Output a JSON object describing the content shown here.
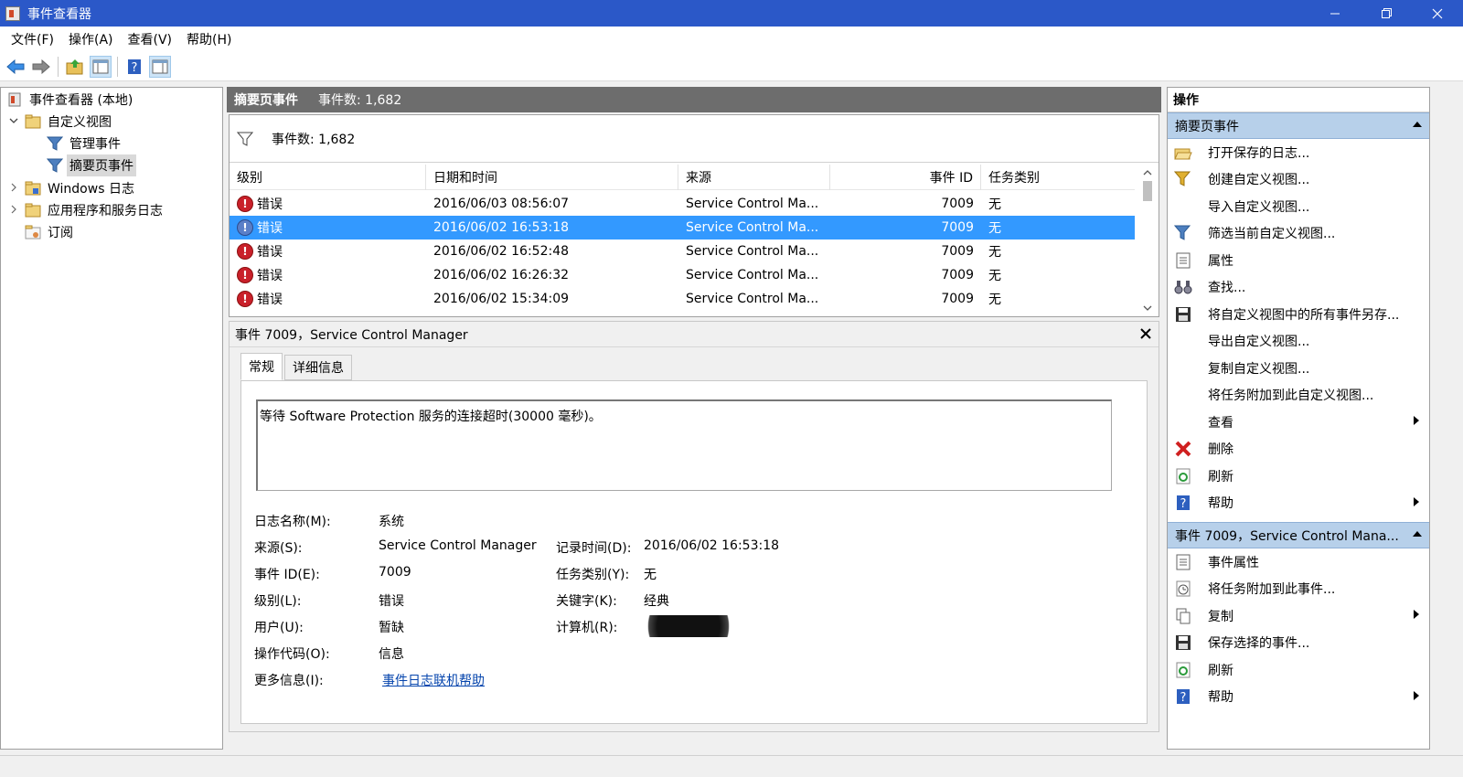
{
  "window": {
    "title": "事件查看器",
    "app_icon": "event-viewer-icon",
    "accent": "#2b58c8"
  },
  "menu": [
    "文件(F)",
    "操作(A)",
    "查看(V)",
    "帮助(H)"
  ],
  "tree": {
    "root": "事件查看器 (本地)",
    "custom_views": "自定义视图",
    "admin_events": "管理事件",
    "summary_events": "摘要页事件",
    "windows_logs": "Windows 日志",
    "app_service_logs": "应用程序和服务日志",
    "subscriptions": "订阅"
  },
  "center": {
    "header_title": "摘要页事件",
    "header_count": "事件数: 1,682",
    "filter_count": "事件数: 1,682",
    "columns": [
      "级别",
      "日期和时间",
      "来源",
      "事件 ID",
      "任务类别"
    ],
    "rows": [
      {
        "level": "错误",
        "datetime": "2016/06/03 08:56:07",
        "source": "Service Control Ma...",
        "id": "7009",
        "category": "无",
        "selected": false
      },
      {
        "level": "错误",
        "datetime": "2016/06/02 16:53:18",
        "source": "Service Control Ma...",
        "id": "7009",
        "category": "无",
        "selected": true
      },
      {
        "level": "错误",
        "datetime": "2016/06/02 16:52:48",
        "source": "Service Control Ma...",
        "id": "7009",
        "category": "无",
        "selected": false
      },
      {
        "level": "错误",
        "datetime": "2016/06/02 16:26:32",
        "source": "Service Control Ma...",
        "id": "7009",
        "category": "无",
        "selected": false
      },
      {
        "level": "错误",
        "datetime": "2016/06/02 15:34:09",
        "source": "Service Control Ma...",
        "id": "7009",
        "category": "无",
        "selected": false
      }
    ]
  },
  "detail": {
    "title": "事件 7009，Service Control Manager",
    "tabs": [
      "常规",
      "详细信息"
    ],
    "message": "等待 Software Protection 服务的连接超时(30000 毫秒)。",
    "log_name_label": "日志名称(M):",
    "log_name": "系统",
    "source_label": "来源(S):",
    "source": "Service Control Manager",
    "logged_label": "记录时间(D):",
    "logged": "2016/06/02 16:53:18",
    "event_id_label": "事件 ID(E):",
    "event_id": "7009",
    "task_label": "任务类别(Y):",
    "task": "无",
    "level_label": "级别(L):",
    "level": "错误",
    "keywords_label": "关键字(K):",
    "keywords": "经典",
    "user_label": "用户(U):",
    "user": "暂缺",
    "computer_label": "计算机(R):",
    "opcode_label": "操作代码(O):",
    "opcode": "信息",
    "more_label": "更多信息(I):",
    "more_link": "事件日志联机帮助"
  },
  "actions": {
    "title": "操作",
    "section1": "摘要页事件",
    "items1": [
      {
        "label": "打开保存的日志...",
        "icon": "folder-open-icon",
        "submenu": false
      },
      {
        "label": "创建自定义视图...",
        "icon": "filter-add-icon",
        "submenu": false
      },
      {
        "label": "导入自定义视图...",
        "icon": "",
        "submenu": false
      },
      {
        "label": "筛选当前自定义视图...",
        "icon": "filter-icon",
        "submenu": false
      },
      {
        "label": "属性",
        "icon": "properties-icon",
        "submenu": false
      },
      {
        "label": "查找...",
        "icon": "binoculars-icon",
        "submenu": false
      },
      {
        "label": "将自定义视图中的所有事件另存...",
        "icon": "save-icon",
        "submenu": false
      },
      {
        "label": "导出自定义视图...",
        "icon": "",
        "submenu": false
      },
      {
        "label": "复制自定义视图...",
        "icon": "",
        "submenu": false
      },
      {
        "label": "将任务附加到此自定义视图...",
        "icon": "",
        "submenu": false
      },
      {
        "label": "查看",
        "icon": "",
        "submenu": true
      },
      {
        "label": "删除",
        "icon": "delete-icon",
        "submenu": false
      },
      {
        "label": "刷新",
        "icon": "refresh-icon",
        "submenu": false
      },
      {
        "label": "帮助",
        "icon": "help-icon",
        "submenu": true
      }
    ],
    "section2": "事件 7009，Service Control Mana...",
    "items2": [
      {
        "label": "事件属性",
        "icon": "properties-icon",
        "submenu": false
      },
      {
        "label": "将任务附加到此事件...",
        "icon": "task-clock-icon",
        "submenu": false
      },
      {
        "label": "复制",
        "icon": "copy-icon",
        "submenu": true
      },
      {
        "label": "保存选择的事件...",
        "icon": "save-icon",
        "submenu": false
      },
      {
        "label": "刷新",
        "icon": "refresh-icon",
        "submenu": false
      },
      {
        "label": "帮助",
        "icon": "help-icon",
        "submenu": true
      }
    ]
  }
}
